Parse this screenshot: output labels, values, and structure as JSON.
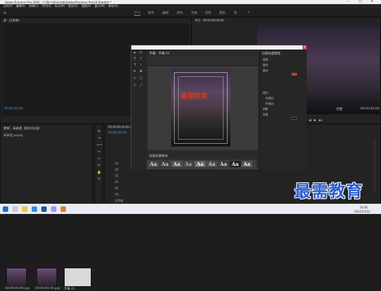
{
  "app": {
    "title": "Adobe Premiere Pro 2020 - C:\\用户\\Killa\\文档\\Adobe\\Premiere Pro\\14.0\\未命名 *",
    "window_controls": [
      "–",
      "□",
      "✕"
    ]
  },
  "menu": [
    "文件(F)",
    "编辑(E)",
    "剪辑(C)",
    "序列(S)",
    "标记(M)",
    "图形(G)",
    "视图(V)",
    "窗口(W)",
    "帮助(H)"
  ],
  "workspaces": [
    "学习",
    "组件",
    "编辑",
    "颜色",
    "效果",
    "音频",
    "图形",
    "库"
  ],
  "active_workspace": "学习",
  "source_panel": {
    "title": "源：(无剪辑)",
    "timecode": "00;00;00;00"
  },
  "program_panel": {
    "title": "节目：00;00;00;00;00",
    "timecode": "00;00;00;00",
    "fit": "完整"
  },
  "project_panel": {
    "tabs": [
      "项目：未命名",
      "媒体浏览器",
      "库",
      "信息"
    ],
    "path": "未命名.prproj",
    "items": [
      {
        "name": "00;00;00;00.jpg",
        "duration": "4;29"
      },
      {
        "name": "00;00;00;00.jpg",
        "duration": "4;29"
      },
      {
        "name": "字幕 01",
        "duration": "4;29"
      }
    ]
  },
  "timeline_panel": {
    "title": "00;00;00;00;00.jpg",
    "timecode": "00;00;00;00",
    "tracks": [
      "V3",
      "V2",
      "V1",
      "A1",
      "A2",
      "A3",
      "主声道"
    ]
  },
  "titler": {
    "title": "字幕：字幕 01",
    "caption_text": "最需教育",
    "properties_title": "旧版标题属性",
    "properties": [
      "变换",
      "属性",
      "填充",
      "描边",
      "内描边",
      "外描边",
      "阴影",
      "背景"
    ],
    "styles_title": "旧版标题样式",
    "style_samples": [
      "Aa",
      "Aa",
      "Aa",
      "Aa",
      "Aa",
      "Aa",
      "Aa",
      "Aa",
      "Aa"
    ]
  },
  "taskbar": {
    "time": "14:40",
    "date": "2021/11/12"
  },
  "watermark": "最需教育",
  "colors": {
    "accent": "#4a8ff0",
    "watermark": "#2c5cd0",
    "close": "#d83a3a"
  }
}
